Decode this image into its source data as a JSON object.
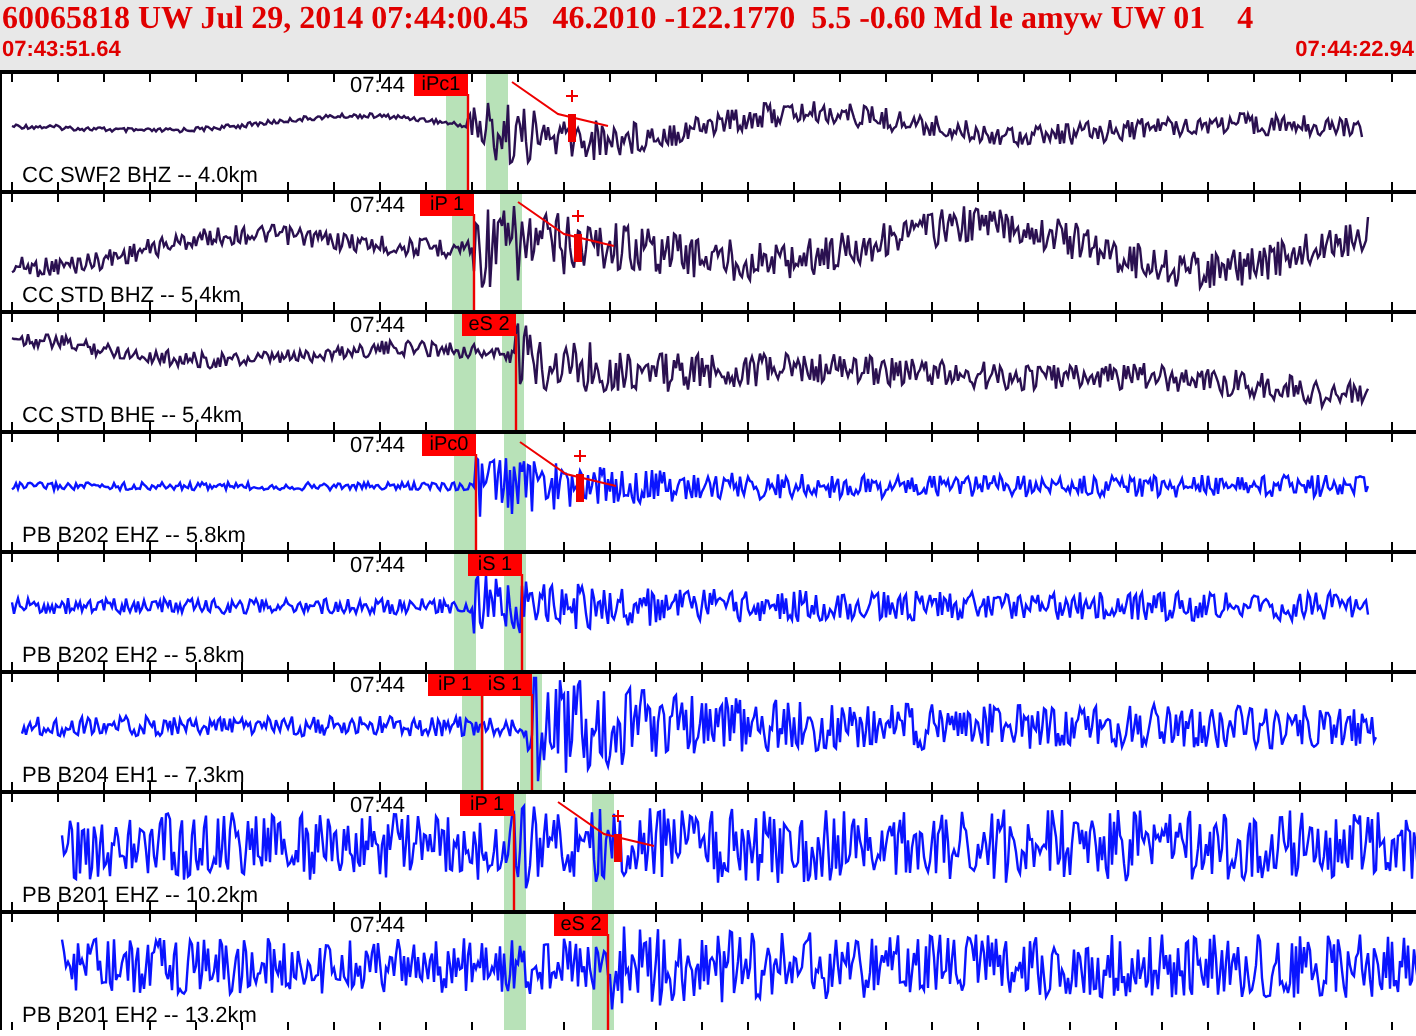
{
  "header": {
    "title": "60065818 UW Jul 29, 2014 07:44:00.45   46.2010 -122.1770  5.5 -0.60 Md le amyw UW 01    4",
    "start_time": "07:43:51.64",
    "end_time": "07:44:22.94"
  },
  "traces": [
    {
      "label": "CC SWF2 BHZ -- 4.0km",
      "time_label": "07:44",
      "color": "#2a1050",
      "picks": [
        {
          "label": "iPc1"
        }
      ]
    },
    {
      "label": "CC STD BHZ -- 5.4km",
      "time_label": "07:44",
      "color": "#2a1050",
      "picks": [
        {
          "label": "iP 1"
        }
      ]
    },
    {
      "label": "CC STD BHE -- 5.4km",
      "time_label": "07:44",
      "color": "#2a1050",
      "picks": [
        {
          "label": "eS 2"
        }
      ]
    },
    {
      "label": "PB B202 EHZ -- 5.8km",
      "time_label": "07:44",
      "color": "#0a14ff",
      "picks": [
        {
          "label": "iPc0"
        }
      ]
    },
    {
      "label": "PB B202 EH2 -- 5.8km",
      "time_label": "07:44",
      "color": "#0a14ff",
      "picks": [
        {
          "label": "iS 1"
        }
      ]
    },
    {
      "label": "PB B204 EH1 -- 7.3km",
      "time_label": "07:44",
      "color": "#0a14ff",
      "picks": [
        {
          "label": "iP 1"
        },
        {
          "label": "iS 1"
        }
      ]
    },
    {
      "label": "PB B201 EHZ -- 10.2km",
      "time_label": "07:44",
      "color": "#0a14ff",
      "picks": [
        {
          "label": "iP 1"
        }
      ]
    },
    {
      "label": "PB B201 EH2 -- 13.2km",
      "time_label": "07:44",
      "color": "#0a14ff",
      "picks": [
        {
          "label": "eS 2"
        }
      ]
    }
  ]
}
